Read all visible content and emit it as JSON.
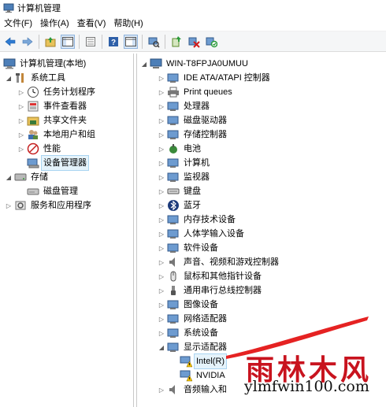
{
  "window": {
    "title": "计算机管理"
  },
  "menu": [
    "文件(F)",
    "操作(A)",
    "查看(V)",
    "帮助(H)"
  ],
  "left_tree": {
    "root": "计算机管理(本地)",
    "system_tools": "系统工具",
    "task_scheduler": "任务计划程序",
    "event_viewer": "事件查看器",
    "shared_folders": "共享文件夹",
    "local_users": "本地用户和组",
    "performance": "性能",
    "device_manager": "设备管理器",
    "storage": "存储",
    "disk_management": "磁盘管理",
    "services": "服务和应用程序"
  },
  "right_tree": {
    "root": "WIN-T8FPJA0UMUU",
    "categories": [
      "IDE ATA/ATAPI 控制器",
      "Print queues",
      "处理器",
      "磁盘驱动器",
      "存储控制器",
      "电池",
      "计算机",
      "监视器",
      "键盘",
      "蓝牙",
      "内存技术设备",
      "人体学输入设备",
      "软件设备",
      "声音、视频和游戏控制器",
      "鼠标和其他指针设备",
      "通用串行总线控制器",
      "图像设备",
      "网络适配器",
      "系统设备",
      "显示适配器"
    ],
    "display_children": [
      "Intel(R)",
      "NVIDIA"
    ],
    "last_item": "音频输入和"
  },
  "watermark": {
    "text": "雨林木风",
    "url": "ylmfwin100.com"
  },
  "colors": {
    "watermark_red": "#c8131e",
    "selection": "#e5f3fb"
  }
}
